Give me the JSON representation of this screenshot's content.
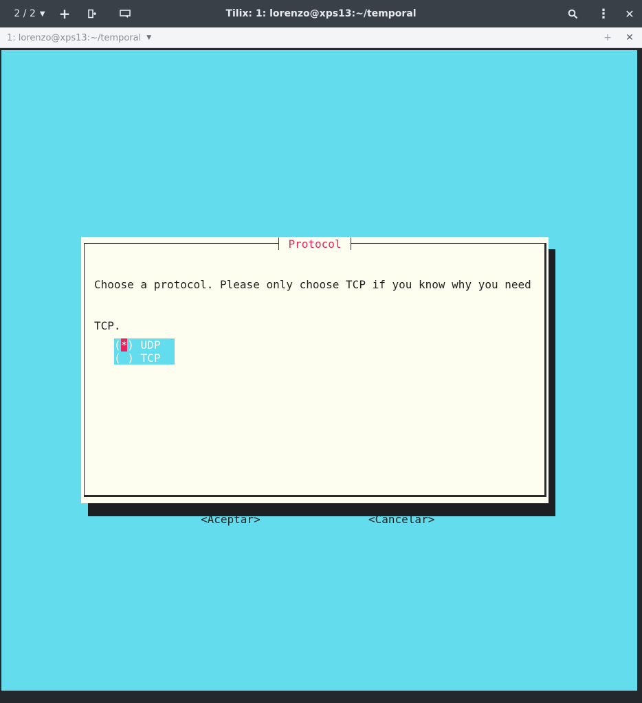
{
  "header": {
    "session_count": "2 / 2",
    "title": "Tilix: 1: lorenzo@xps13:~/temporal",
    "icons": [
      "chevron-down-icon",
      "add-icon",
      "split-terminal-icon",
      "sidebar-icon",
      "search-icon",
      "menu-icon",
      "close-icon"
    ]
  },
  "tab": {
    "label": "1: lorenzo@xps13:~/temporal"
  },
  "dialog": {
    "title": "Protocol",
    "message_line1": "Choose a protocol. Please only choose TCP if you know why you need",
    "message_line2": "TCP.",
    "options": [
      {
        "open": "(",
        "mark": "*",
        "close": ") UDP ",
        "label": "UDP",
        "selected": true
      },
      {
        "open": "(",
        "mark": " ",
        "close": ") TCP ",
        "label": "TCP",
        "selected": false
      }
    ],
    "ok_label": "<Aceptar>",
    "cancel_label": "<Cancelar>"
  },
  "colors": {
    "terminal_bg": "#63dced",
    "dialog_bg": "#fdfdf0",
    "accent": "#e7235e",
    "headerbar_bg": "#3a4048"
  }
}
